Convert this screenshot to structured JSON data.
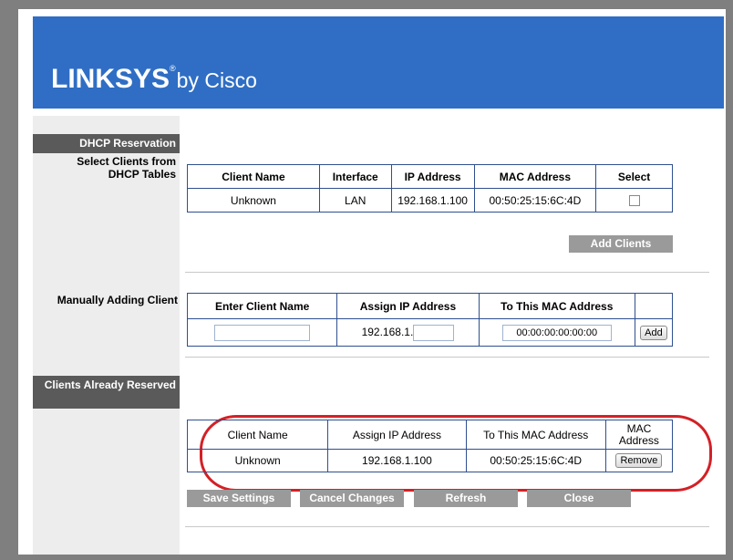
{
  "brand": {
    "name": "LINKSYS",
    "reg": "®",
    "by": "by Cisco"
  },
  "sections": {
    "dhcp_reservation": "DHCP Reservation",
    "select_clients": "Select Clients from DHCP Tables",
    "manually_adding": "Manually Adding Client",
    "clients_reserved": "Clients Already Reserved"
  },
  "dhcp_table": {
    "headers": [
      "Client Name",
      "Interface",
      "IP Address",
      "MAC Address",
      "Select"
    ],
    "row": {
      "name": "Unknown",
      "interface": "LAN",
      "ip": "192.168.1.100",
      "mac": "00:50:25:15:6C:4D"
    }
  },
  "add_clients_label": "Add Clients",
  "manual_table": {
    "headers": [
      "Enter Client Name",
      "Assign IP Address",
      "To This MAC Address"
    ],
    "client_name_value": "",
    "ip_prefix": "192.168.1.",
    "ip_last_value": "",
    "mac_value": "00:00:00:00:00:00",
    "add_label": "Add"
  },
  "reserved_table": {
    "headers": [
      "Client Name",
      "Assign IP Address",
      "To This MAC Address",
      "MAC Address"
    ],
    "row": {
      "name": "Unknown",
      "ip": "192.168.1.100",
      "mac": "00:50:25:15:6C:4D"
    },
    "remove_label": "Remove"
  },
  "footer_buttons": {
    "save": "Save Settings",
    "cancel": "Cancel Changes",
    "refresh": "Refresh",
    "close": "Close"
  },
  "colors": {
    "header_blue": "#2f6ec4",
    "section_dark": "#5a5a5a",
    "button_gray": "#9a9a9a",
    "highlight_red": "#d32026"
  }
}
